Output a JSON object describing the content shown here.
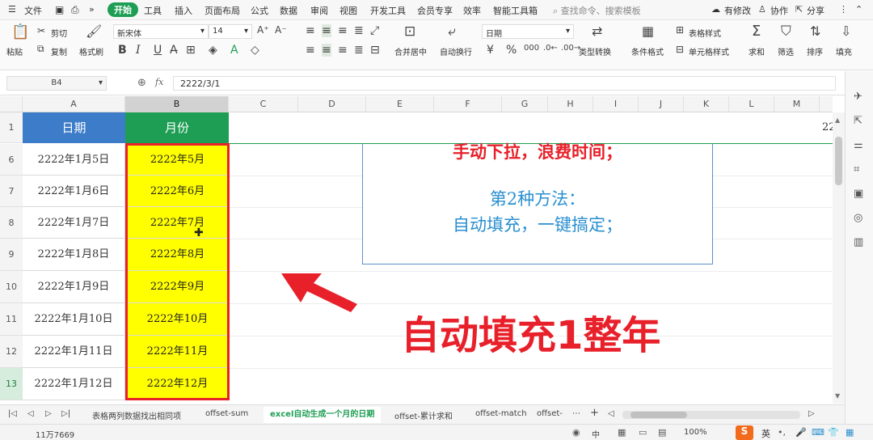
{
  "menubar": {
    "file_label": "文件",
    "items": [
      "开始",
      "工具",
      "插入",
      "页面布局",
      "公式",
      "数据",
      "审阅",
      "视图",
      "开发工具",
      "会员专享",
      "效率",
      "智能工具箱"
    ],
    "search_placeholder": "查找命令、搜索模板",
    "right": [
      "有修改",
      "协作",
      "分享"
    ]
  },
  "ribbon": {
    "paste": "粘贴",
    "cut": "剪切",
    "copy": "复制",
    "format_painter": "格式刷",
    "font_name": "新宋体",
    "font_size": "14",
    "merge_center": "合并居中",
    "auto_wrap": "自动换行",
    "number_format": "日期",
    "type_convert": "类型转换",
    "cond_format": "条件格式",
    "table_style": "表格样式",
    "cell_style": "单元格样式",
    "sum": "求和",
    "filter": "筛选",
    "sort": "排序",
    "fill": "填充"
  },
  "formulabar": {
    "cell_ref": "B4",
    "fx_label": "fx",
    "formula": "2222/3/1"
  },
  "columns": [
    "A",
    "B",
    "C",
    "D",
    "E",
    "F",
    "G",
    "H",
    "I",
    "J",
    "K",
    "L",
    "M"
  ],
  "headers": {
    "a": "日期",
    "b": "月份",
    "m_partial": "22"
  },
  "rows": [
    {
      "num": "1"
    },
    {
      "num": "6",
      "a": "2222年1月5日",
      "b": "2222年5月"
    },
    {
      "num": "7",
      "a": "2222年1月6日",
      "b": "2222年6月"
    },
    {
      "num": "8",
      "a": "2222年1月7日",
      "b": "2222年7月"
    },
    {
      "num": "9",
      "a": "2222年1月8日",
      "b": "2222年8月"
    },
    {
      "num": "10",
      "a": "2222年1月9日",
      "b": "2222年9月"
    },
    {
      "num": "11",
      "a": "2222年1月10日",
      "b": "2222年10月"
    },
    {
      "num": "12",
      "a": "2222年1月11日",
      "b": "2222年11月"
    },
    {
      "num": "13",
      "a": "2222年1月12日",
      "b": "2222年12月"
    }
  ],
  "textbox": {
    "line1": "手动下拉，浪费时间；",
    "line2": "第2种方法：",
    "line3": "自动填充，一键搞定；"
  },
  "overlay_caption": "自动填充1整年",
  "sheet_tabs": [
    "表格两列数据找出相同项",
    "offset-sum",
    "excel自动生成一个月的日期",
    "offset-累计求和",
    "offset-match",
    "offset-"
  ],
  "status": {
    "count": "11万7669",
    "zoom": "100%",
    "ime": "英",
    "lang": "中"
  },
  "colors": {
    "header_a": "#3d7cc9",
    "header_b": "#1e9e54",
    "highlight": "#ffff00",
    "red": "#e8202a",
    "blue": "#2a8fd0"
  }
}
